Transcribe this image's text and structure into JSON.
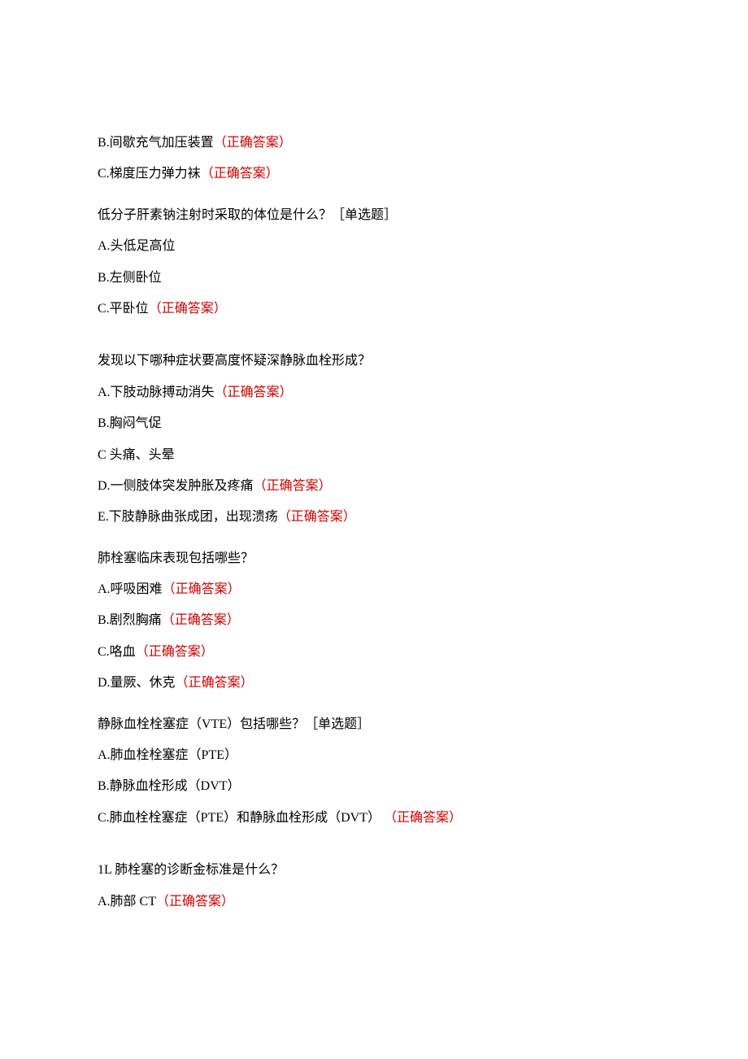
{
  "q1_partial": {
    "optB": "B.间歇充气加压装置",
    "optB_mark": "（正确答案）",
    "optC": "C.梯度压力弹力袜",
    "optC_mark": "（正确答案）"
  },
  "q2": {
    "question": "低分子肝素钠注射时采取的体位是什么？［单选题］",
    "optA": "A.头低足高位",
    "optB": "B.左侧卧位",
    "optC": "C.平卧位",
    "optC_mark": "（正确答案）"
  },
  "q3": {
    "question": "发现以下哪种症状要高度怀疑深静脉血栓形成？",
    "optA": "A.下肢动脉搏动消失",
    "optA_mark": "（正确答案）",
    "optB": "B.胸闷气促",
    "optC": "C 头痛、头晕",
    "optD": "D.一侧肢体突发肿胀及疼痛",
    "optD_mark": "（正确答案）",
    "optE": "E.下肢静脉曲张成团，出现溃疡",
    "optE_mark": "（正确答案）"
  },
  "q4": {
    "question": "肺栓塞临床表现包括哪些？",
    "optA": "A.呼吸困难",
    "optA_mark": "（正确答案）",
    "optB": "B.剧烈胸痛",
    "optB_mark": "（正确答案）",
    "optC": "C.咯血",
    "optC_mark": "（正确答案）",
    "optD": "D.量厥、休克",
    "optD_mark": "（正确答案）"
  },
  "q5": {
    "question": "静脉血栓栓塞症（VTE）包括哪些？［单选题］",
    "optA": "A.肺血栓栓塞症（PTE）",
    "optB": "B.静脉血栓形成（DVT）",
    "optC": "C.肺血栓栓塞症（PTE）和静脉血栓形成（DVT）",
    "optC_mark": "（正确答案）"
  },
  "q6": {
    "question": "1L 肺栓塞的诊断金标准是什么？",
    "optA": "A.肺部 CT",
    "optA_mark": "（正确答案）"
  }
}
